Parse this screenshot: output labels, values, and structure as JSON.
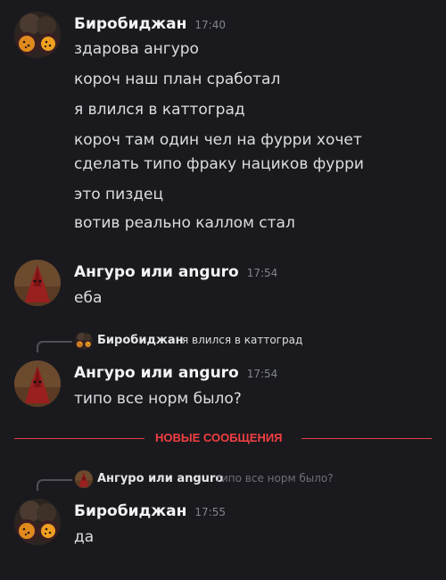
{
  "messages": [
    {
      "author": "Биробиджан",
      "time": "17:40",
      "lines": [
        "здарова ангуро",
        "короч наш план сработал",
        "я влился в каттоград",
        "короч там один чел на фурри хочет",
        "сделать типо фраку нациков фурри",
        "это пиздец",
        "вотив реально каллом стал"
      ]
    },
    {
      "author": "Ангуро или anguro",
      "time": "17:54",
      "lines": [
        "еба"
      ]
    },
    {
      "reply": {
        "author": "Биробиджан",
        "text": "я влился в каттоград"
      },
      "author": "Ангуро или anguro",
      "time": "17:54",
      "lines": [
        "типо все норм было?"
      ]
    },
    {
      "reply": {
        "author": "Ангуро или anguro",
        "text": "типо все норм было?"
      },
      "author": "Биробиджан",
      "time": "17:55",
      "lines": [
        "да"
      ]
    }
  ],
  "divider": {
    "label": "НОВЫЕ СООБЩЕНИЯ"
  },
  "colors": {
    "background": "#1a1a1e",
    "text": "#dbdee1",
    "muted": "#80848e",
    "new_messages": "#f23f42"
  },
  "icons": {
    "avatar_1": "passionfruit-avatar",
    "avatar_2": "red-hood-figure-avatar"
  }
}
